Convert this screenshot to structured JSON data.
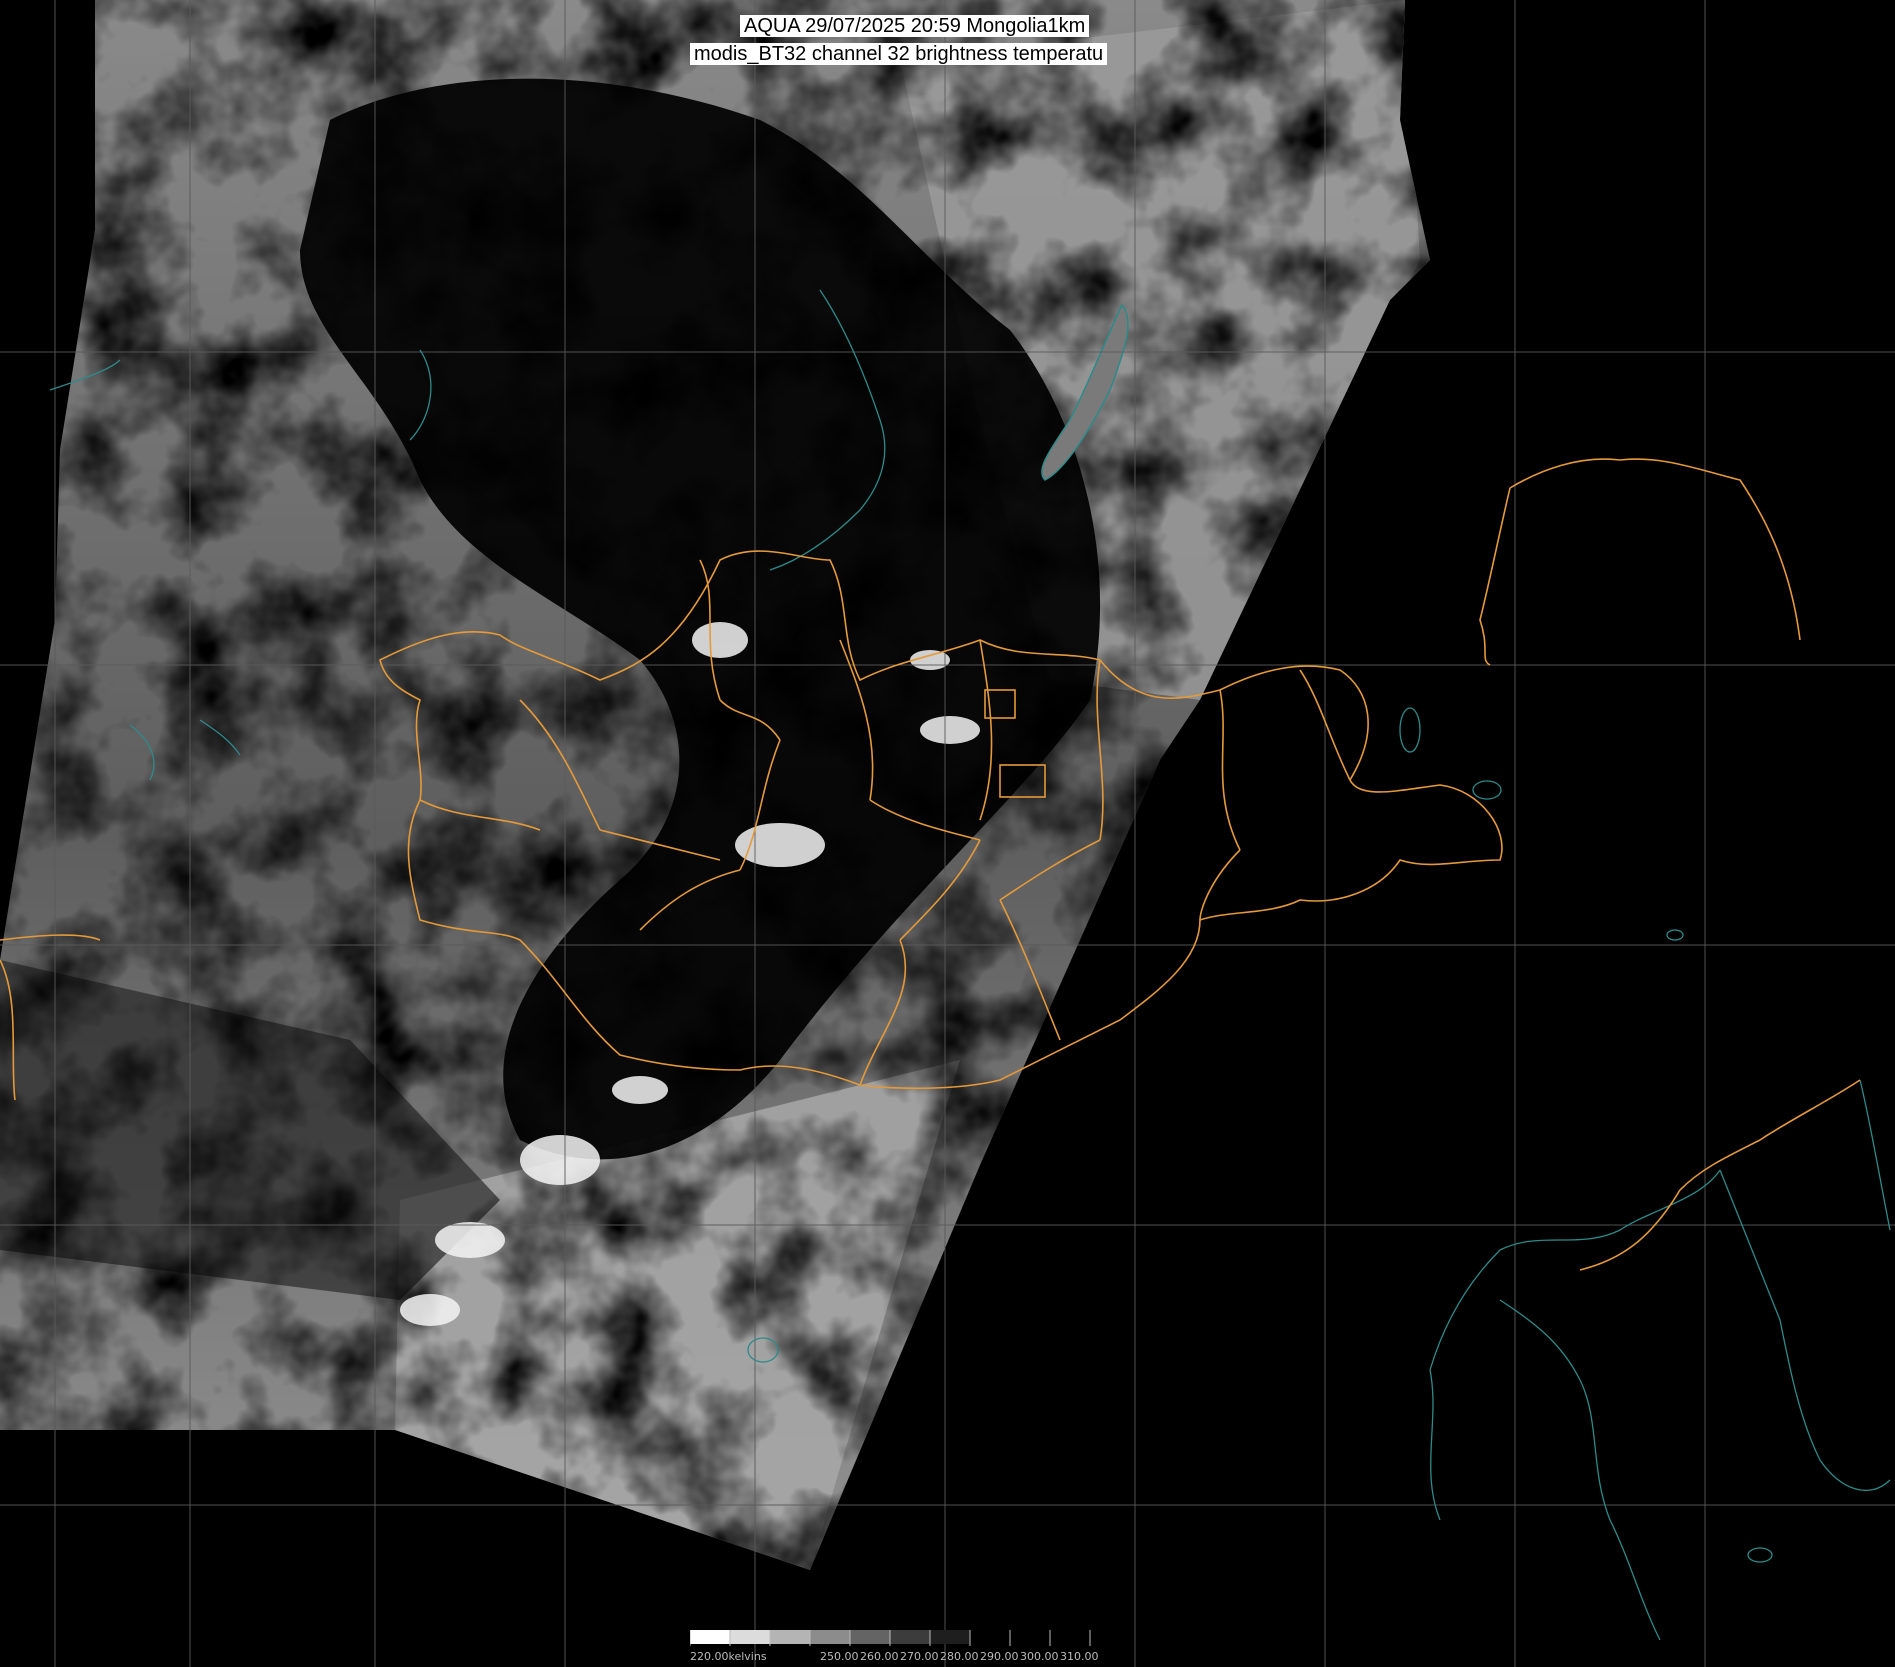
{
  "title": {
    "line1": "AQUA 29/07/2025 20:59 Mongolia1km",
    "line2": "modis_BT32 channel 32 brightness temperatu"
  },
  "colorbar": {
    "unit": "kelvins",
    "tick_labels": [
      "220.00kelvins",
      "250.00",
      "260.00",
      "270.00",
      "280.00",
      "290.00",
      "300.00",
      "310.00"
    ],
    "colors": [
      "#ffffff",
      "#dcdcdc",
      "#b4b4b4",
      "#8c8c8c",
      "#646464",
      "#3c3c3c",
      "#1e1e1e",
      "#000000"
    ]
  },
  "styles": {
    "background": "#000000",
    "graticule_color": "#5a5a5a",
    "border_color": "#e59a3a",
    "coast_color": "#2e8a8a"
  }
}
